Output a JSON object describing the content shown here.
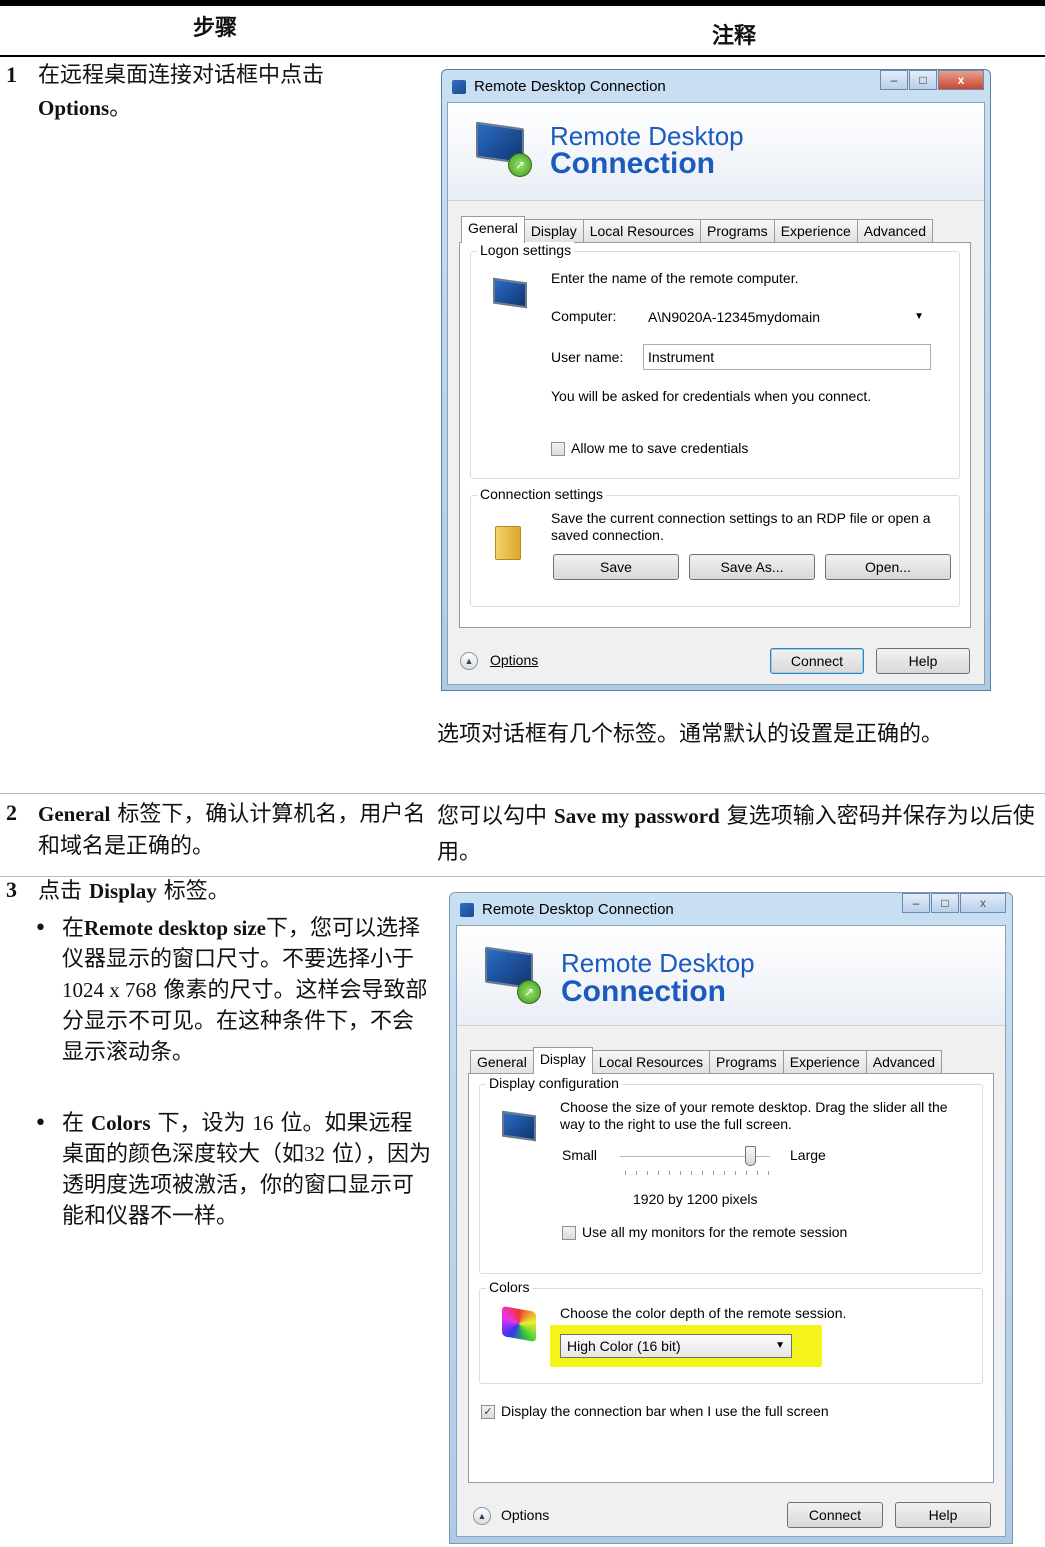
{
  "table": {
    "header_step": "步骤",
    "header_note": "注释"
  },
  "step1": {
    "num": "1",
    "text_cn": "在远程桌面连接对话框中点击",
    "text_bold": "Options",
    "text_end": "。",
    "note": "选项对话框有几个标签。通常默认的设置是正确的。"
  },
  "step2": {
    "num": "2",
    "bold": "General",
    "text": "标签下，确认计算机名，用户名和域名是正确的。",
    "note_a": "您可以勾中",
    "note_bold": "Save my password",
    "note_b": "复选项输入密码并保存为以后使用。"
  },
  "step3": {
    "num": "3",
    "text_a": "点击",
    "bold": "Display",
    "text_b": "标签。",
    "bullet1_a": "在",
    "bullet1_bold": "Remote desktop size",
    "bullet1_b": "下，您可以选择仪器显示的窗口尺寸。不要选择小于",
    "bullet1_size": "1024 x 768",
    "bullet1_c": "像素的尺寸。这样会导致部分显示不可见。在这种条件下，不会显示滚动条。",
    "bullet2_a": "在",
    "bullet2_bold": "Colors",
    "bullet2_b": "下，设为",
    "bullet2_16": "16",
    "bullet2_c": "位。如果远程桌面的颜色深度较大（如",
    "bullet2_32": "32",
    "bullet2_d": "位），因为透明度选项被激活，你的窗口显示可能和仪器不一样。"
  },
  "dialog1": {
    "title": "Remote Desktop Connection",
    "banner_line1": "Remote Desktop",
    "banner_line2": "Connection",
    "tabs": [
      "General",
      "Display",
      "Local Resources",
      "Programs",
      "Experience",
      "Advanced"
    ],
    "logon_group": "Logon settings",
    "logon_hint": "Enter the name of the remote computer.",
    "computer_label": "Computer:",
    "computer_value": "A\\N9020A-12345mydomain",
    "username_label": "User name:",
    "username_value": "Instrument",
    "credentials_note": "You will be asked for credentials when you connect.",
    "allow_save": "Allow me to save credentials",
    "conn_group": "Connection settings",
    "conn_text_1": "Save the current connection settings to an RDP file or open a",
    "conn_text_2": "saved connection.",
    "save": "Save",
    "save_as": "Save As...",
    "open": "Open...",
    "options": "Options",
    "connect": "Connect",
    "help": "Help"
  },
  "dialog2": {
    "title": "Remote Desktop Connection",
    "banner_line1": "Remote Desktop",
    "banner_line2": "Connection",
    "tabs": [
      "General",
      "Display",
      "Local Resources",
      "Programs",
      "Experience",
      "Advanced"
    ],
    "display_group": "Display configuration",
    "display_text_1": "Choose the size of your remote desktop. Drag the slider all the",
    "display_text_2": "way to the right to use the full screen.",
    "small": "Small",
    "large": "Large",
    "resolution": "1920 by 1200 pixels",
    "all_monitors": "Use all my monitors for the remote session",
    "colors_group": "Colors",
    "colors_text": "Choose the color depth of the remote session.",
    "color_value": "High Color (16 bit)",
    "conn_bar": "Display the connection bar when I use the full screen",
    "options": "Options",
    "connect": "Connect",
    "help": "Help"
  }
}
